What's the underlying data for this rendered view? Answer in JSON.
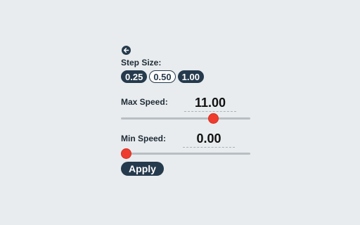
{
  "back": {
    "icon": "arrow-left-icon"
  },
  "step_size": {
    "label": "Step Size:",
    "options": [
      "0.25",
      "0.50",
      "1.00"
    ],
    "selected": [
      "0.25",
      "1.00"
    ]
  },
  "max_speed": {
    "label": "Max Speed:",
    "value": "11.00",
    "slider_fraction": 0.71
  },
  "min_speed": {
    "label": "Min Speed:",
    "value": "0.00",
    "slider_fraction": 0.04
  },
  "apply_label": "Apply",
  "colors": {
    "background": "#e8ecee",
    "primary": "#263a4d",
    "accent": "#ee3b2e",
    "track": "#b8bec3"
  }
}
